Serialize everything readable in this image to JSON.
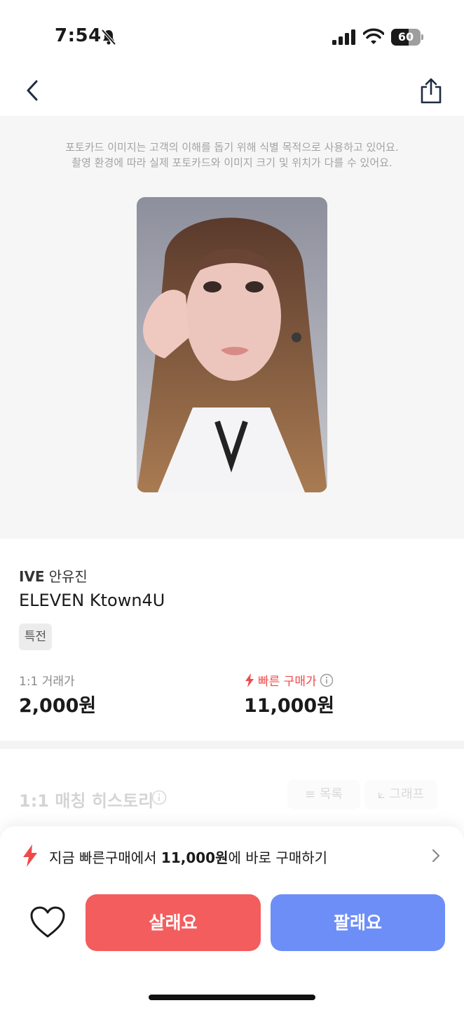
{
  "status_bar": {
    "time": "7:54",
    "battery": "60",
    "battery_level": 0.6
  },
  "notice": {
    "line1": "포토카드 이미지는 고객의 이해를 돕기 위해 식별 목적으로 사용하고 있어요.",
    "line2": "촬영 환경에 따라 실제 포토카드와 이미지 크기 및 위치가 다를 수 있어요."
  },
  "product": {
    "group": "IVE",
    "member": "안유진",
    "title": "ELEVEN Ktown4U",
    "tag": "특전"
  },
  "prices": {
    "trade_label": "1:1 거래가",
    "trade_value": "2,000원",
    "quick_label": "빠른 구매가",
    "quick_value": "11,000원"
  },
  "history": {
    "title": "1:1 매칭 히스토리",
    "list_label": "≡ 목록",
    "graph_label": "⟀ 그래프"
  },
  "quick_buy": {
    "prefix": "지금 빠른구매에서 ",
    "amount": "11,000원",
    "suffix": "에 바로 구매하기"
  },
  "actions": {
    "buy_label": "살래요",
    "sell_label": "팔래요"
  },
  "colors": {
    "buy": "#f45d5d",
    "sell": "#6e8ef7",
    "accent_red": "#ef4a4a"
  },
  "icons": [
    "bell-slash-icon",
    "signal-icon",
    "wifi-icon",
    "back-icon",
    "share-icon",
    "bolt-icon",
    "info-icon",
    "chevron-right-icon",
    "heart-icon"
  ]
}
